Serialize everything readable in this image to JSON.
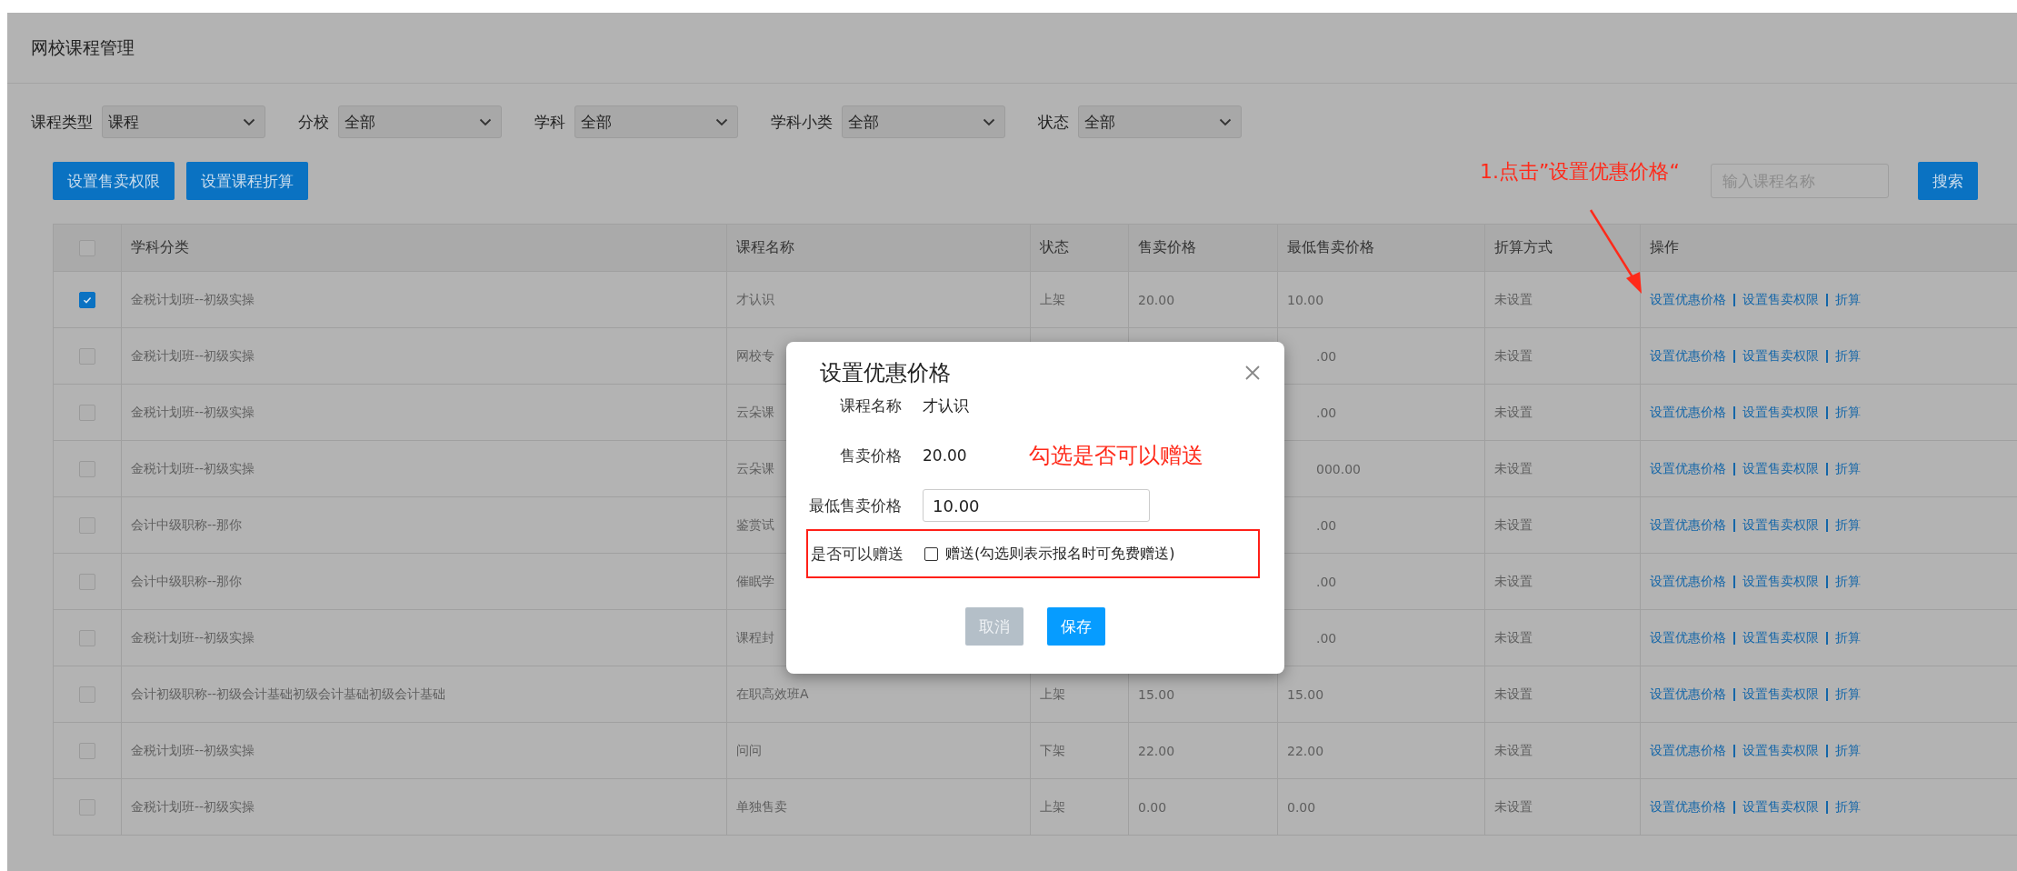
{
  "page": {
    "title": "网校课程管理"
  },
  "filters": [
    {
      "label": "课程类型",
      "value": "课程"
    },
    {
      "label": "分校",
      "value": "全部"
    },
    {
      "label": "学科",
      "value": "全部"
    },
    {
      "label": "学科小类",
      "value": "全部"
    },
    {
      "label": "状态",
      "value": "全部"
    }
  ],
  "toolbar": {
    "buttons": [
      "设置售卖权限",
      "设置课程折算"
    ],
    "search": {
      "placeholder": "输入课程名称"
    },
    "search_button": "搜索"
  },
  "table": {
    "select_all_checked": false,
    "columns": [
      "学科分类",
      "课程名称",
      "状态",
      "售卖价格",
      "最低售卖价格",
      "折算方式",
      "操作"
    ],
    "rows": [
      {
        "checked": true,
        "category": "金税计划班--初级实操",
        "name": "才认识",
        "status": "上架",
        "price": "20.00",
        "min_price": "10.00",
        "conversion": "未设置",
        "actions": [
          "设置优惠价格",
          "设置售卖权限",
          "折算"
        ]
      },
      {
        "checked": false,
        "category": "金税计划班--初级实操",
        "name": "网校专",
        "min_price": ".00",
        "conversion": "未设置",
        "actions": [
          "设置优惠价格",
          "设置售卖权限",
          "折算"
        ]
      },
      {
        "checked": false,
        "category": "金税计划班--初级实操",
        "name": "云朵课",
        "min_price": ".00",
        "conversion": "未设置",
        "actions": [
          "设置优惠价格",
          "设置售卖权限",
          "折算"
        ]
      },
      {
        "checked": false,
        "category": "金税计划班--初级实操",
        "name": "云朵课",
        "min_price": "000.00",
        "conversion": "未设置",
        "actions": [
          "设置优惠价格",
          "设置售卖权限",
          "折算"
        ]
      },
      {
        "checked": false,
        "category": "会计中级职称--那你",
        "name": "鉴赏试",
        "min_price": ".00",
        "conversion": "未设置",
        "actions": [
          "设置优惠价格",
          "设置售卖权限",
          "折算"
        ]
      },
      {
        "checked": false,
        "category": "会计中级职称--那你",
        "name": "催眠学",
        "min_price": ".00",
        "conversion": "未设置",
        "actions": [
          "设置优惠价格",
          "设置售卖权限",
          "折算"
        ]
      },
      {
        "checked": false,
        "category": "金税计划班--初级实操",
        "name": "课程封",
        "min_price": ".00",
        "conversion": "未设置",
        "actions": [
          "设置优惠价格",
          "设置售卖权限",
          "折算"
        ]
      },
      {
        "checked": false,
        "category": "会计初级职称--初级会计基础初级会计基础初级会计基础",
        "name": "在职高效班A",
        "status": "上架",
        "price": "15.00",
        "min_price": "15.00",
        "conversion": "未设置",
        "actions": [
          "设置优惠价格",
          "设置售卖权限",
          "折算"
        ]
      },
      {
        "checked": false,
        "category": "金税计划班--初级实操",
        "name": "问问",
        "status": "下架",
        "price": "22.00",
        "min_price": "22.00",
        "conversion": "未设置",
        "actions": [
          "设置优惠价格",
          "设置售卖权限",
          "折算"
        ]
      },
      {
        "checked": false,
        "category": "金税计划班--初级实操",
        "name": "单独售卖",
        "status": "上架",
        "price": "0.00",
        "min_price": "0.00",
        "conversion": "未设置",
        "actions": [
          "设置优惠价格",
          "设置售卖权限",
          "折算"
        ]
      }
    ]
  },
  "dialog": {
    "title": "设置优惠价格",
    "course_label": "课程名称",
    "course_value": "才认识",
    "price_label": "售卖价格",
    "price_value": "20.00",
    "min_price_label": "最低售卖价格",
    "min_price_value": "10.00",
    "gift_label": "是否可以赠送",
    "gift_checked": false,
    "gift_text": "赠送(勾选则表示报名时可免费赠送)",
    "buttons": [
      {
        "label": "取消",
        "kind": "cancel"
      },
      {
        "label": "保存",
        "kind": "primary"
      }
    ]
  },
  "annotations": [
    {
      "kind": "arrow-note",
      "text": "1.点击”设置优惠价格“"
    },
    {
      "kind": "box-note",
      "text": "勾选是否可以赠送"
    }
  ]
}
